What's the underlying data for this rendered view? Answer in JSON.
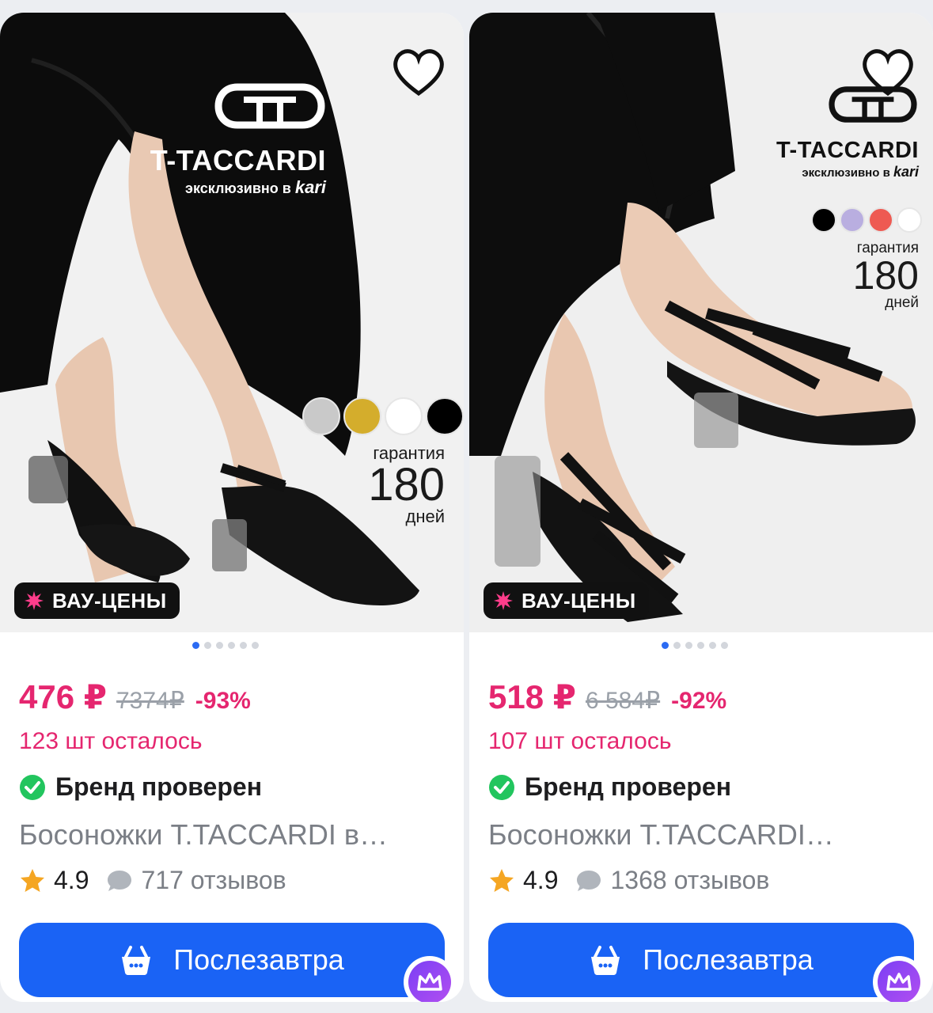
{
  "products": [
    {
      "brand_name": "T-TACCARDI",
      "exclusive_text": "эксклюзивно в",
      "exclusive_store": "kari",
      "swatches": [
        "#c9c9c9",
        "#d4ad2c",
        "#ffffff",
        "#000000"
      ],
      "warranty_line1": "гарантия",
      "warranty_days": "180",
      "warranty_line3": "дней",
      "badge": "ВАУ-ЦЕНЫ",
      "image_count": 6,
      "active_image": 0,
      "price": "476 ₽",
      "old_price": "7374₽",
      "discount": "-93%",
      "stock_left": "123 шт осталось",
      "verified": "Бренд проверен",
      "title": "Босоножки T.TACCARDI в…",
      "rating": "4.9",
      "reviews": "717 отзывов",
      "cart_label": "Послезавтра"
    },
    {
      "brand_name": "T-TACCARDI",
      "exclusive_text": "эксклюзивно в",
      "exclusive_store": "kari",
      "swatches": [
        "#000000",
        "#b9aee0",
        "#ee5a52",
        "#ffffff"
      ],
      "warranty_line1": "гарантия",
      "warranty_days": "180",
      "warranty_line3": "дней",
      "badge": "ВАУ-ЦЕНЫ",
      "image_count": 6,
      "active_image": 0,
      "price": "518 ₽",
      "old_price": "6 584₽",
      "discount": "-92%",
      "stock_left": "107 шт осталось",
      "verified": "Бренд проверен",
      "title": "Босоножки T.TACCARDI…",
      "rating": "4.9",
      "reviews": "1368 отзывов",
      "cart_label": "Послезавтра"
    }
  ],
  "colors": {
    "accent_pink": "#e5266f",
    "button_blue": "#1a63f5",
    "verified_green": "#22c55e",
    "star_orange": "#f5a623"
  },
  "icons": [
    "heart-icon",
    "burst-icon",
    "check-circle-icon",
    "star-icon",
    "chat-bubble-icon",
    "basket-icon",
    "crown-icon"
  ]
}
